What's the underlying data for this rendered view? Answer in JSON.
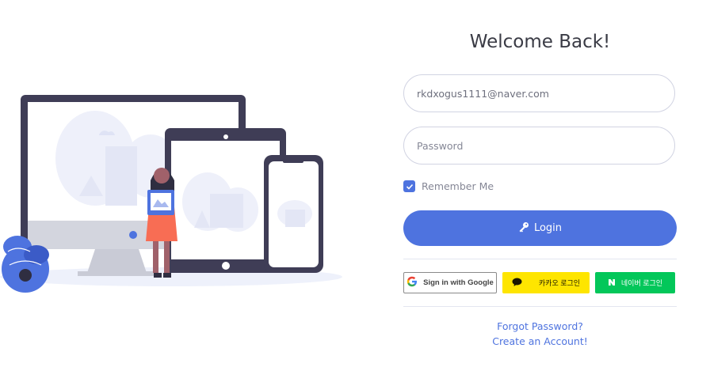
{
  "login": {
    "title": "Welcome Back!",
    "email_value": "rkdxogus1111@naver.com",
    "password_placeholder": "Password",
    "remember_label": "Remember Me",
    "remember_checked": true,
    "login_label": "Login",
    "google_label": "Sign in with Google",
    "kakao_label": "카카오 로그인",
    "naver_label": "네이버 로그인",
    "forgot_label": "Forgot Password?",
    "create_label": "Create an Account!"
  },
  "icons": {
    "key": "key-icon",
    "google": "google-logo-icon",
    "kakao": "kakao-speech-bubble-icon",
    "naver": "naver-n-icon",
    "check": "check-icon"
  },
  "colors": {
    "primary": "#4e73df",
    "kakao": "#fee500",
    "naver": "#03c75a",
    "illustration_dark": "#3f3d56",
    "illustration_person": "#f86d54"
  }
}
